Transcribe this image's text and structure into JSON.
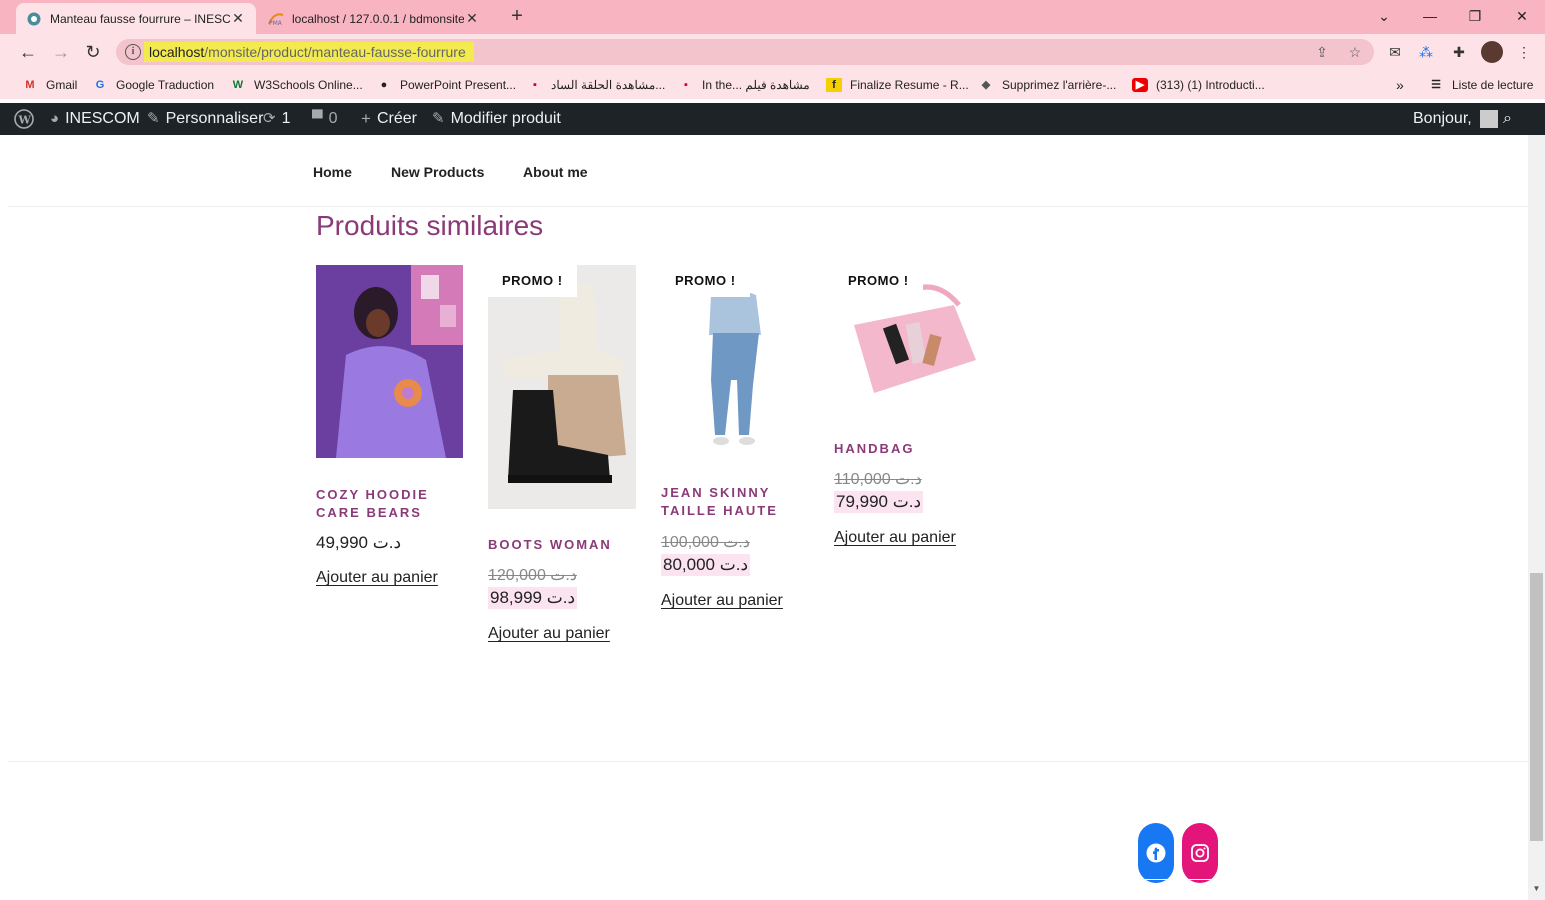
{
  "browser": {
    "tabs": [
      {
        "title": "Manteau fausse fourrure – INESCO",
        "active": true
      },
      {
        "title": "localhost / 127.0.0.1 / bdmonsite",
        "active": false
      }
    ],
    "url_host": "localhost",
    "url_path": "/monsite/product/manteau-fausse-fourrure",
    "bookmarks": [
      "Gmail",
      "Google Traduction",
      "W3Schools Online...",
      "PowerPoint Present...",
      "مشاهدة الحلقة الساد...",
      "In the... مشاهدة فيلم",
      "Finalize Resume - R...",
      "Supprimez l'arrière-...",
      "(313) (1) Introducti..."
    ],
    "bookmarks_overflow": "»",
    "reading_list": "Liste de lecture"
  },
  "adminbar": {
    "site": "INESCOM",
    "customize": "Personnaliser",
    "updates_count": "1",
    "comments_count": "0",
    "create": "Créer",
    "edit": "Modifier produit",
    "greeting": "Bonjour,"
  },
  "nav": {
    "items": [
      "Home",
      "New Products",
      "About me"
    ]
  },
  "section_title": "Produits similaires",
  "products": [
    {
      "name_line1": "COZY HOODIE",
      "name_line2": "CARE BEARS",
      "old_price": "",
      "price": "49,990 د.ت",
      "promo": "",
      "add": "Ajouter au panier"
    },
    {
      "name_line1": "BOOTS WOMAN",
      "name_line2": "",
      "old_price": "120,000 د.ت",
      "price": "98,999 د.ت",
      "promo": "PROMO !",
      "add": "Ajouter au panier"
    },
    {
      "name_line1": "JEAN SKINNY",
      "name_line2": "TAILLE HAUTE",
      "old_price": "100,000 د.ت",
      "price": "80,000 د.ت",
      "promo": "PROMO !",
      "add": "Ajouter au panier"
    },
    {
      "name_line1": "HANDBAG",
      "name_line2": "",
      "old_price": "110,000 د.ت",
      "price": "79,990 د.ت",
      "promo": "PROMO !",
      "add": "Ajouter au panier"
    }
  ],
  "colors": {
    "tab_bar": "#f8b4c0",
    "accent": "#8b3a78",
    "facebook": "#1877f2",
    "instagram": "#e4157a"
  }
}
